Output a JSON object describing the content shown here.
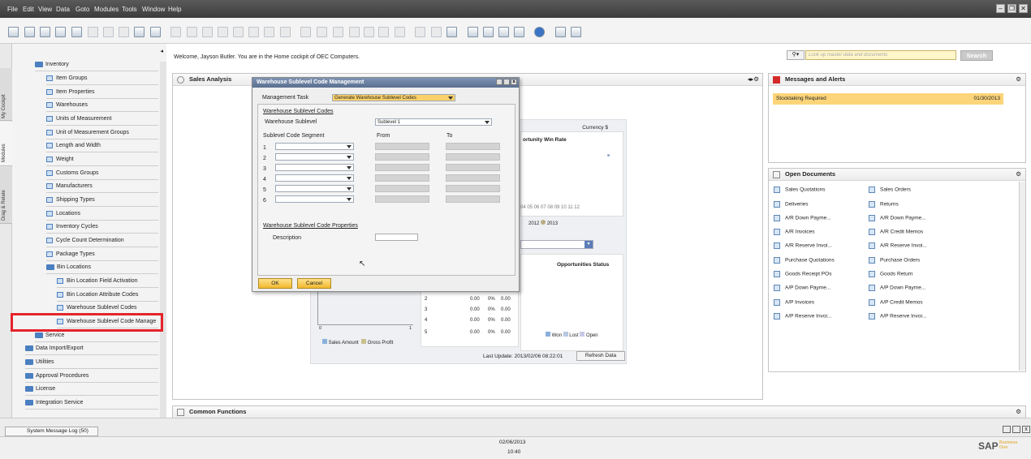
{
  "menu": [
    "File",
    "Edit",
    "View",
    "Data",
    "Goto",
    "Modules",
    "Tools",
    "Window",
    "Help"
  ],
  "sidebar_tabs": [
    "My Cockpit",
    "Modules",
    "Drag & Relate"
  ],
  "tree": {
    "items": [
      {
        "label": "Inventory",
        "type": "folder"
      },
      {
        "label": "Item Groups",
        "type": "doc"
      },
      {
        "label": "Item Properties",
        "type": "doc"
      },
      {
        "label": "Warehouses",
        "type": "doc"
      },
      {
        "label": "Units of Measurement",
        "type": "doc"
      },
      {
        "label": "Unit of Measurement Groups",
        "type": "doc"
      },
      {
        "label": "Length and Width",
        "type": "doc"
      },
      {
        "label": "Weight",
        "type": "doc"
      },
      {
        "label": "Customs Groups",
        "type": "doc"
      },
      {
        "label": "Manufacturers",
        "type": "doc"
      },
      {
        "label": "Shipping Types",
        "type": "doc"
      },
      {
        "label": "Locations",
        "type": "doc"
      },
      {
        "label": "Inventory Cycles",
        "type": "doc"
      },
      {
        "label": "Cycle Count Determination",
        "type": "doc"
      },
      {
        "label": "Package Types",
        "type": "doc"
      },
      {
        "label": "Bin Locations",
        "type": "folder"
      },
      {
        "label": "Bin Location Field Activation",
        "type": "doc"
      },
      {
        "label": "Bin Location Attribute Codes",
        "type": "doc"
      },
      {
        "label": "Warehouse Sublevel Codes",
        "type": "doc"
      },
      {
        "label": "Warehouse Sublevel Code Manage",
        "type": "doc"
      },
      {
        "label": "Service",
        "type": "folder"
      },
      {
        "label": "Data Import/Export",
        "type": "folder"
      },
      {
        "label": "Utilities",
        "type": "folder"
      },
      {
        "label": "Approval Procedures",
        "type": "folder"
      },
      {
        "label": "License",
        "type": "folder"
      },
      {
        "label": "Integration Service",
        "type": "folder"
      }
    ]
  },
  "welcome": "Welcome, Jayson Butler. You are in the Home cockpit of OEC Computers.",
  "search": {
    "placeholder": "Look up master data and documents",
    "button": "Search"
  },
  "sales_panel": {
    "title": "Sales Analysis",
    "currency": "Currency $",
    "win_rate_title": "ortunity Win Rate",
    "months": "04  05  06  07  08  09  10  11  12",
    "legend_years": [
      "2012",
      "2013"
    ],
    "opp_status_title": "Opportunities Status",
    "qty_header": "ntity",
    "rows": [
      {
        "n": "3",
        "a": "0.00",
        "p": "0%",
        "b": "0.00"
      },
      {
        "n": "4",
        "a": "0.00",
        "p": "0%",
        "b": "0.00"
      },
      {
        "n": "5",
        "a": "0.00",
        "p": "0%",
        "b": "0.00"
      }
    ],
    "rows_top": [
      {
        "n": "2",
        "a": "0.00",
        "p": "0%",
        "b": "0.00"
      }
    ],
    "axis_zero": "0",
    "axis_one": "1",
    "legend_sales": [
      "Sales Amount",
      "Gross Profit"
    ],
    "legend_opp": [
      "Won",
      "Lost",
      "Open"
    ],
    "last_update": "Last Update: 2013/02/06 08:22:01",
    "refresh": "Refresh Data"
  },
  "messages": {
    "title": "Messages and Alerts",
    "alert": "Stocktaking Required",
    "date": "01/30/2013"
  },
  "open_docs": {
    "title": "Open Documents",
    "left": [
      "Sales Quotations",
      "Deliveries",
      "A/R Down Payme...",
      "A/R Invoices",
      "A/R Reserve Invoi...",
      "Purchase Quotations",
      "Goods Receipt POs",
      "A/P Down Payme...",
      "A/P Invoices",
      "A/P Reserve Invoi..."
    ],
    "right": [
      "Sales Orders",
      "Returns",
      "A/R Down Payme...",
      "A/R Credit Memos",
      "A/R Reserve Invoi...",
      "Purchase Orders",
      "Goods Return",
      "A/P Down Payme...",
      "A/P Credit Memos",
      "A/P Reserve Invoi..."
    ]
  },
  "common_functions": "Common Functions",
  "dialog": {
    "title": "Warehouse Sublevel Code Management",
    "task_label": "Management Task",
    "task_value": "Generate Warehouse Sublevel Codes",
    "section1": "Warehouse Sublevel Codes",
    "sublevel_label": "Warehouse Sublevel",
    "sublevel_value": "Sublevel 1",
    "col_segment": "Sublevel Code Segment",
    "col_from": "From",
    "col_to": "To",
    "rows": [
      "1",
      "2",
      "3",
      "4",
      "5",
      "6"
    ],
    "section2": "Warehouse Sublevel Code Properties",
    "desc_label": "Description",
    "ok": "OK",
    "cancel": "Cancel"
  },
  "status": {
    "log": "System Message Log (50)",
    "date": "02/06/2013",
    "time": "10:40",
    "brand": "SAP",
    "brand_sub": "Business One"
  }
}
